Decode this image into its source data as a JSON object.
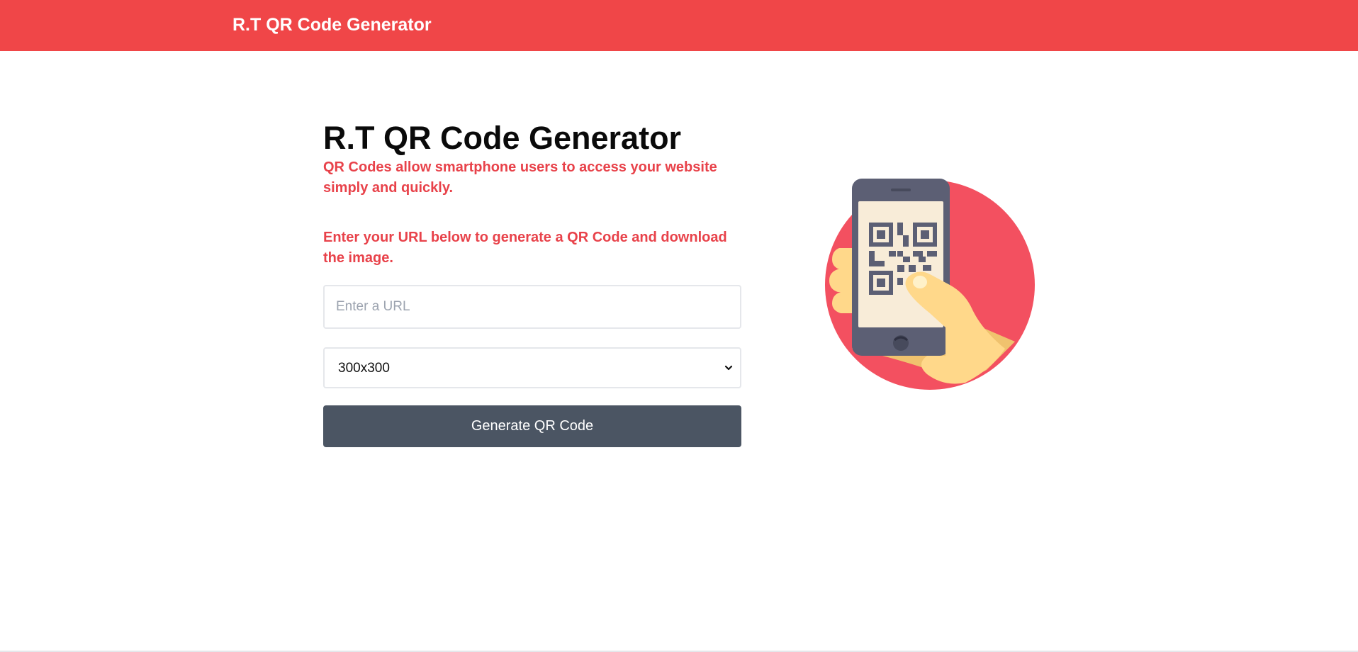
{
  "header": {
    "brand": "R.T QR Code Generator",
    "background_color": "#f04648"
  },
  "main": {
    "title": "R.T QR Code Generator",
    "description_1": "QR Codes allow smartphone users to access your website simply and quickly.",
    "description_2": "Enter your URL below to generate a QR Code and download the image.",
    "url_input": {
      "value": "",
      "placeholder": "Enter a URL"
    },
    "size_select": {
      "selected": "300x300"
    },
    "generate_button": {
      "label": "Generate QR Code",
      "color": "#4b5563"
    },
    "accent_color": "#e8424a"
  },
  "illustration": {
    "icon": "hand-holding-phone-qr-icon"
  }
}
